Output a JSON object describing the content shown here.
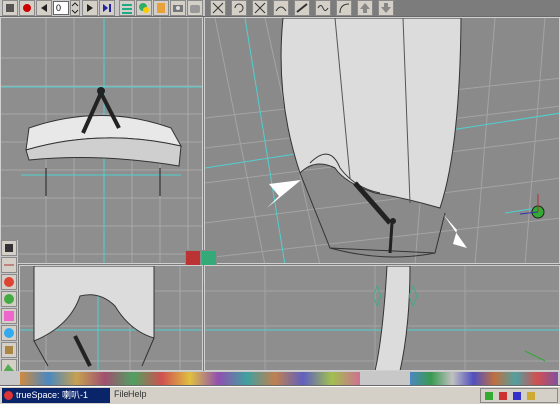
{
  "app": {
    "frame_field_value": "0",
    "colors": {
      "viewport_bg": "#8e8e8e",
      "grid": "#a4a4a4",
      "axis": "#6fc8c8",
      "model_fill": "#d8d8d8",
      "toolbar": "#c8c8c8",
      "taskbar": "#d4d0c8",
      "taskbar_title": "#0a246a"
    }
  },
  "toolbar_left": {
    "icons": [
      "render-icon",
      "record-icon",
      "rewind-icon",
      "frame-field",
      "stepper-icon",
      "play-icon",
      "end-icon",
      "list-icon",
      "material-icon",
      "paint-icon",
      "camera-icon"
    ]
  },
  "toolbar_right": {
    "icons": [
      "move-icon",
      "rotate-icon",
      "scale-icon",
      "deform-icon",
      "knife-icon",
      "tweak-icon",
      "bend-icon",
      "up-arrow-icon",
      "down-arrow-icon"
    ]
  },
  "left_panel": {
    "icons": [
      "save-icon",
      "layers-icon",
      "sphere-icon",
      "primitives-icon",
      "color-palette-icon",
      "material-ball-icon",
      "cube-icon",
      "terrain-icon",
      "light-icon",
      "camera-tool-icon",
      "deform-tool-icon",
      "render-tool-icon",
      "scene-icon",
      "misc-icon"
    ]
  },
  "viewports": [
    {
      "name": "viewport-top-left",
      "view": "front"
    },
    {
      "name": "viewport-perspective",
      "view": "perspective"
    },
    {
      "name": "viewport-bottom-left",
      "view": "top"
    },
    {
      "name": "viewport-bottom-right",
      "view": "side"
    }
  ],
  "bottom_toolbar": {
    "icons": [
      "torus-icon",
      "sphere-icon",
      "cone-icon",
      "paint-icon",
      "sword-icon",
      "rope-icon",
      "plant-icon",
      "flower-icon",
      "box-icon",
      "smiley-icon",
      "flag-icon",
      "wave-icon",
      "link-icon",
      "planet-icon",
      "palette-icon",
      "ring-icon",
      "checker-icon",
      "gear-icon",
      "pencil-icon",
      "chart-icon",
      "face-icon",
      "skin-icon",
      "wire-icon",
      "render-icon",
      "grid-icon",
      "grid2-icon",
      "mirror-icon",
      "cup-icon",
      "world-icon",
      "x-icon"
    ]
  },
  "taskbar": {
    "title": "trueSpace: 喇叭-1",
    "menus": [
      "File",
      "Help"
    ]
  }
}
